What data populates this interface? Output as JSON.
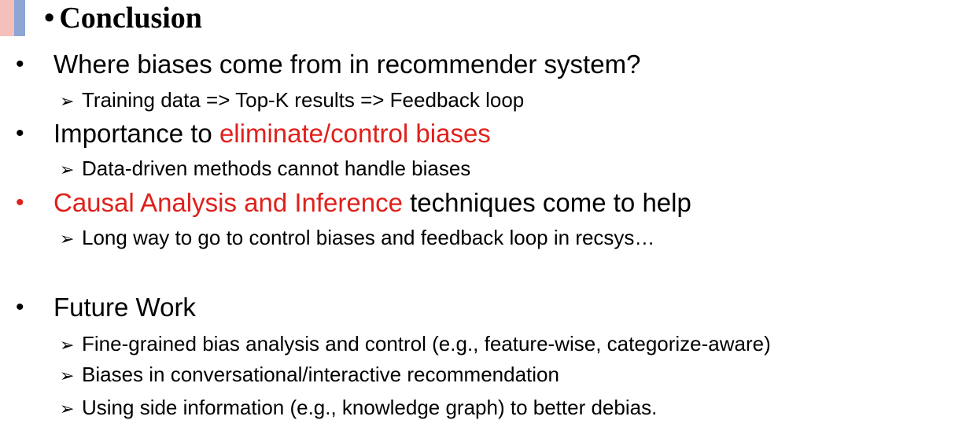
{
  "colors": {
    "accent": "#e0201b",
    "bar_left": "#f4c0bc",
    "bar_right": "#8ea6d6"
  },
  "title": "Conclusion",
  "title_bullet": "•",
  "bullet_glyph": "•",
  "arrow_glyph": "➢",
  "bullets": [
    {
      "parts": [
        {
          "text": "Where biases come from in recommender system?",
          "highlight": false
        }
      ],
      "subs": [
        "Training data => Top-K results => Feedback loop"
      ]
    },
    {
      "parts": [
        {
          "text": "Importance to ",
          "highlight": false
        },
        {
          "text": "eliminate/control biases",
          "highlight": true
        }
      ],
      "subs": [
        "Data-driven methods cannot handle biases"
      ]
    },
    {
      "bullet_highlight": true,
      "parts": [
        {
          "text": "Causal Analysis and Inference",
          "highlight": true
        },
        {
          "text": " techniques come to help",
          "highlight": false
        }
      ],
      "subs": [
        "Long way to go to control biases and feedback loop in recsys…"
      ]
    },
    {
      "parts": [
        {
          "text": "Future Work",
          "highlight": false
        }
      ],
      "subs": [
        "Fine-grained bias analysis and control (e.g., feature-wise, categorize-aware)",
        "Biases in conversational/interactive recommendation",
        "Using side information (e.g., knowledge graph) to better debias."
      ]
    }
  ]
}
